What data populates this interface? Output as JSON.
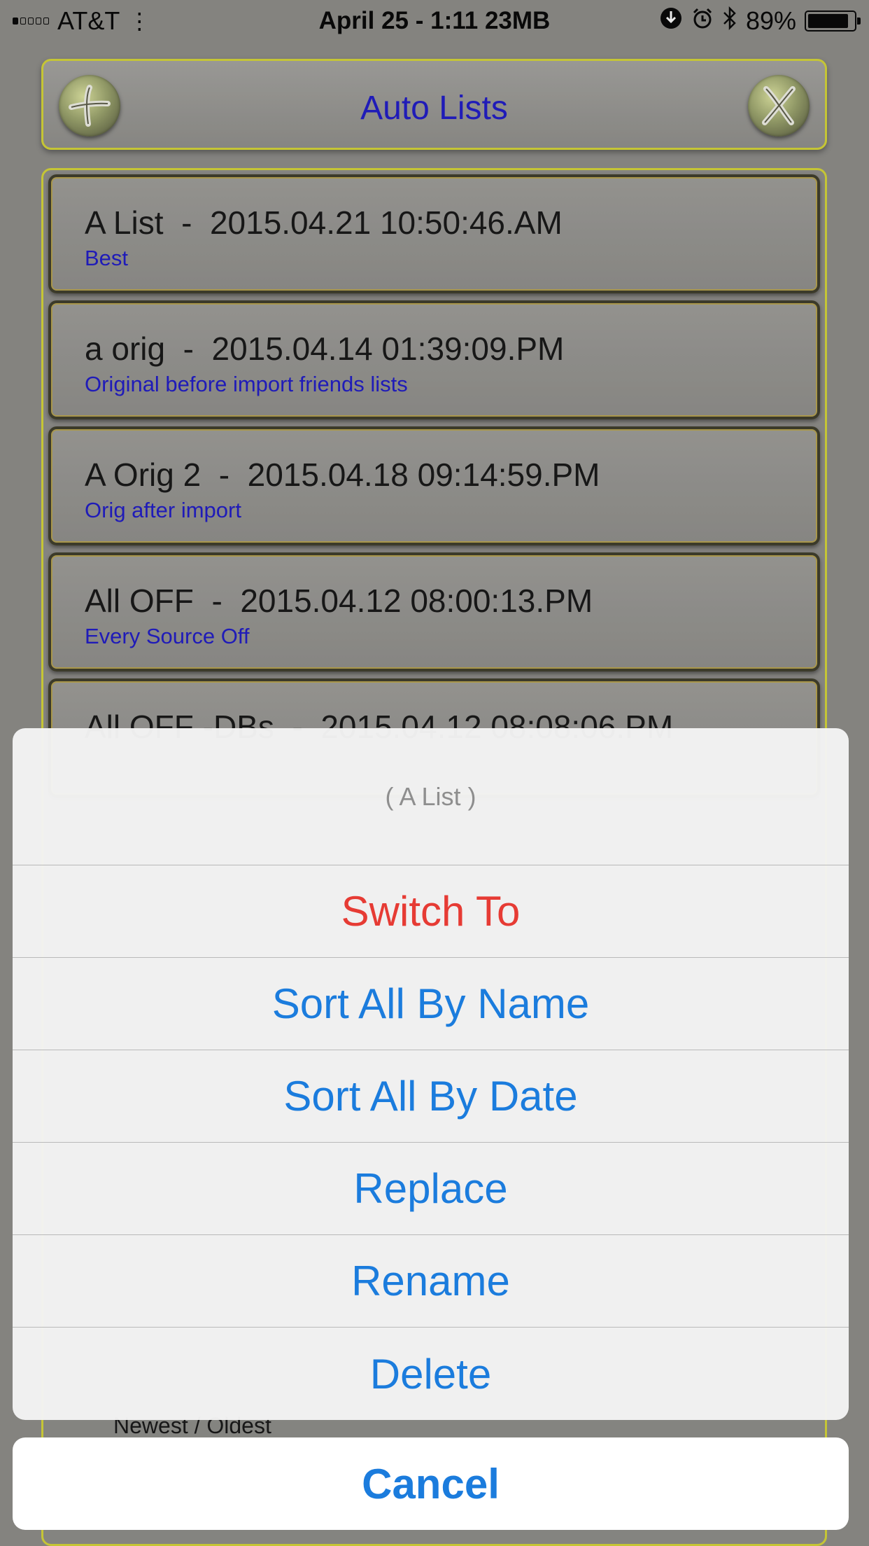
{
  "status_bar": {
    "carrier": "AT&T",
    "center_text": "April 25 - 1:11  23MB",
    "battery_percent": "89%",
    "battery_level": 0.89,
    "signal_bars_filled": 1,
    "icons": [
      "wifi-icon",
      "download-icon",
      "alarm-icon",
      "bluetooth-icon",
      "battery-icon"
    ]
  },
  "header": {
    "title": "Auto Lists",
    "left_button_icon": "add-icon",
    "right_button_icon": "close-icon",
    "accent_color": "#d7d733",
    "title_color": "#1a15c8"
  },
  "lists": [
    {
      "title": "A List  -  2015.04.21 10:50:46.AM",
      "subtitle": "Best"
    },
    {
      "title": "a orig  -  2015.04.14 01:39:09.PM",
      "subtitle": "Original before import friends lists"
    },
    {
      "title": "A Orig 2  -  2015.04.18 09:14:59.PM",
      "subtitle": "Orig after import"
    },
    {
      "title": "All OFF  -  2015.04.12 08:00:13.PM",
      "subtitle": "Every Source Off"
    },
    {
      "title": "All OFF -DBs  -  2015.04.12 08:08:06.PM",
      "subtitle": ""
    }
  ],
  "bottom_peek_text": "Newest / Oldest",
  "action_sheet": {
    "title": "( A List )",
    "buttons": [
      {
        "label": "Switch To",
        "style": "destructive"
      },
      {
        "label": "Sort All By Name",
        "style": "default"
      },
      {
        "label": "Sort All By Date",
        "style": "default"
      },
      {
        "label": "Replace",
        "style": "default"
      },
      {
        "label": "Rename",
        "style": "default"
      },
      {
        "label": "Delete",
        "style": "default"
      }
    ],
    "cancel_label": "Cancel",
    "button_color": "#1b7cdd",
    "destructive_color": "#e63b34"
  }
}
